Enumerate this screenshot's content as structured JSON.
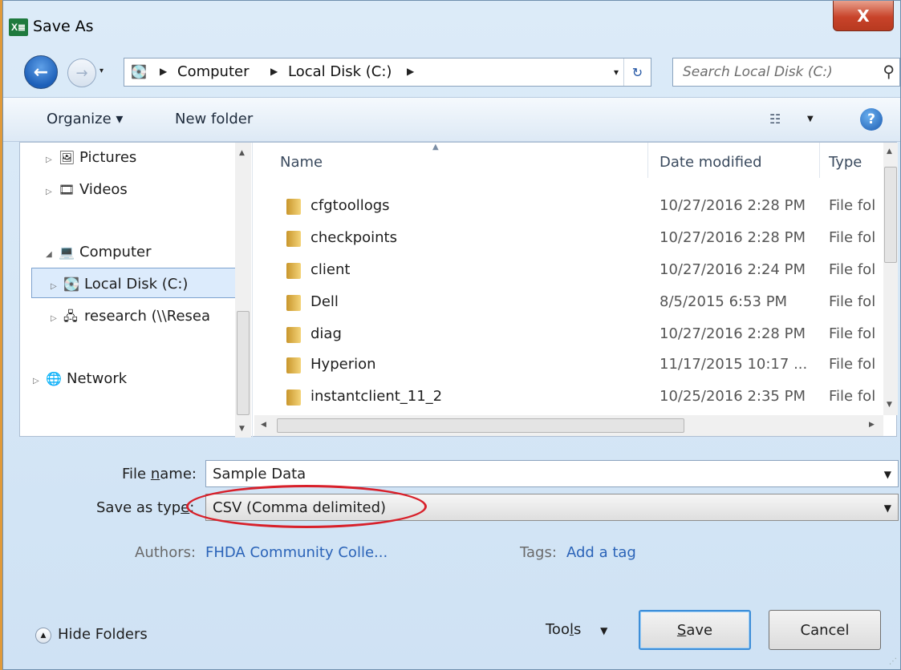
{
  "window": {
    "title": "Save As",
    "app_icon": "X≣",
    "close_glyph": "X"
  },
  "nav": {
    "back_glyph": "←",
    "forward_glyph": "→",
    "history_glyph": "▾",
    "breadcrumb": [
      "Computer",
      "Local Disk (C:)"
    ],
    "crumb_sep": "▶",
    "drop_glyph": "▾",
    "refresh_glyph": "↻",
    "search_placeholder": "Search Local Disk (C:)",
    "search_glyph": "⚲"
  },
  "toolbar": {
    "organize": "Organize ▾",
    "new_folder": "New folder",
    "help": "?"
  },
  "sidebar": {
    "items": [
      {
        "label": "Pictures",
        "icon": "🖼",
        "tri": "▷"
      },
      {
        "label": "Videos",
        "icon": "🎞",
        "tri": "▷"
      },
      {
        "label": "Computer",
        "icon": "💻",
        "tri": "◢"
      },
      {
        "label": "Local Disk (C:)",
        "icon": "💽",
        "tri": "▷"
      },
      {
        "label": "research (\\\\Resea",
        "icon": "🖧",
        "tri": "▷"
      },
      {
        "label": "Network",
        "icon": "🌐",
        "tri": "▷"
      }
    ]
  },
  "files": {
    "headers": {
      "name": "Name",
      "date": "Date modified",
      "type": "Type"
    },
    "rows": [
      {
        "name": "cfgtoollogs",
        "date": "10/27/2016 2:28 PM",
        "type": "File fol"
      },
      {
        "name": "checkpoints",
        "date": "10/27/2016 2:28 PM",
        "type": "File fol"
      },
      {
        "name": "client",
        "date": "10/27/2016 2:24 PM",
        "type": "File fol"
      },
      {
        "name": "Dell",
        "date": "8/5/2015 6:53 PM",
        "type": "File fol"
      },
      {
        "name": "diag",
        "date": "10/27/2016 2:28 PM",
        "type": "File fol"
      },
      {
        "name": "Hyperion",
        "date": "11/17/2015 10:17 ...",
        "type": "File fol"
      },
      {
        "name": "instantclient_11_2",
        "date": "10/25/2016 2:35 PM",
        "type": "File fol"
      }
    ]
  },
  "form": {
    "filename_label_pre": "File ",
    "filename_label_u": "n",
    "filename_label_post": "ame:",
    "filename_value": "Sample Data",
    "type_label_pre": "Save as typ",
    "type_label_u": "e",
    "type_label_post": ":",
    "type_value": "CSV (Comma delimited)",
    "authors_label": "Authors:",
    "authors_value": "FHDA Community Colle...",
    "tags_label": "Tags:",
    "tags_value": "Add a tag"
  },
  "footer": {
    "hide_folders": "Hide Folders",
    "tools_pre": "Too",
    "tools_u": "l",
    "tools_post": "s",
    "tools_drop": "▼",
    "save_u": "S",
    "save_post": "ave",
    "cancel": "Cancel"
  }
}
